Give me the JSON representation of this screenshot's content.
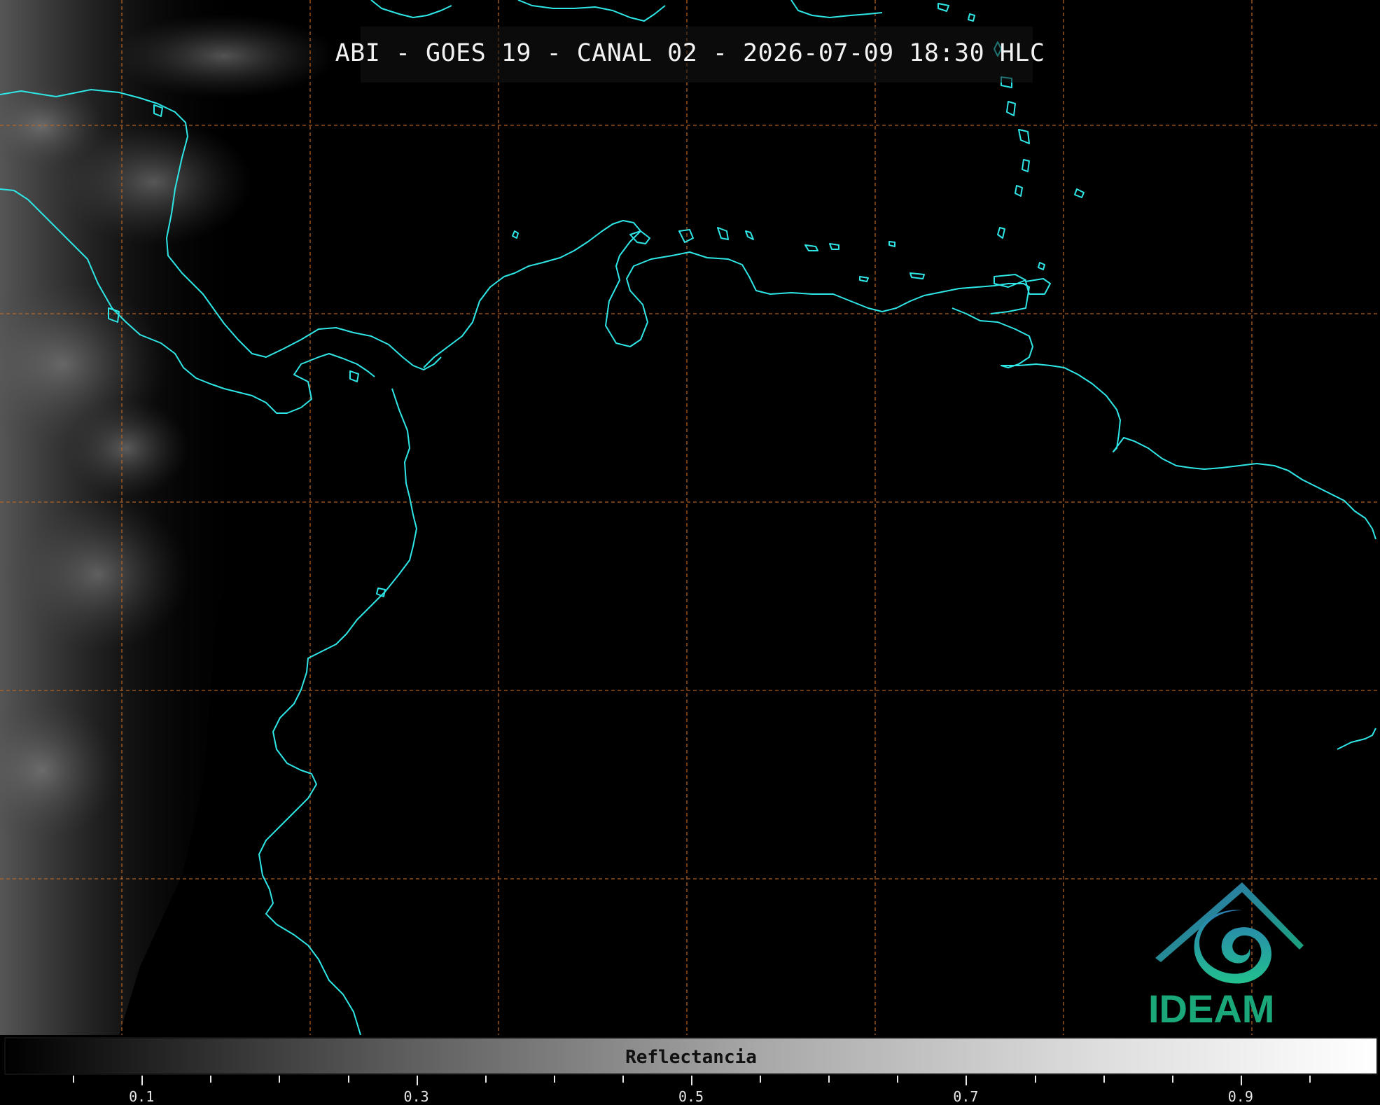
{
  "title": "ABI - GOES 19 - CANAL 02 - 2026-07-09 18:30 HLC",
  "colorbar": {
    "label": "Reflectancia",
    "range": [
      0.0,
      1.0
    ],
    "ticks": [
      0.05,
      0.1,
      0.15,
      0.2,
      0.25,
      0.3,
      0.35,
      0.4,
      0.45,
      0.5,
      0.55,
      0.6,
      0.65,
      0.7,
      0.75,
      0.8,
      0.85,
      0.9,
      0.95
    ],
    "labeled_ticks": [
      "0.1",
      "0.3",
      "0.5",
      "0.7",
      "0.9"
    ]
  },
  "logo": {
    "text": "IDEAM"
  },
  "colors": {
    "coastline": "#2fe6e6",
    "gridline": "#c06a28",
    "background": "#000000",
    "title": "#f2f2f2",
    "logo_blue": "#2f6fb0",
    "logo_green": "#1aa77a"
  },
  "map": {
    "grid": true,
    "coastlines": true
  }
}
